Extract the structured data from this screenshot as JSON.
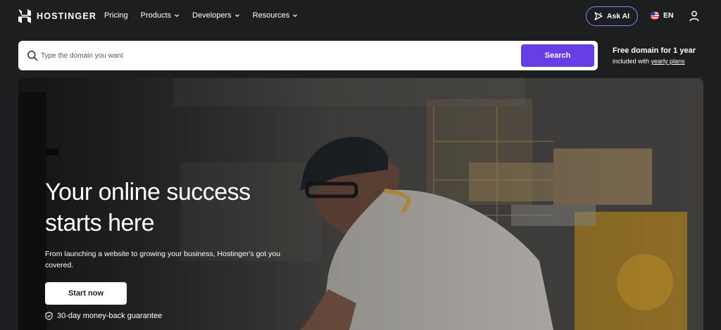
{
  "header": {
    "brand": "HOSTINGER",
    "menu": [
      {
        "label": "Pricing",
        "dropdown": false
      },
      {
        "label": "Products",
        "dropdown": true
      },
      {
        "label": "Developers",
        "dropdown": true
      },
      {
        "label": "Resources",
        "dropdown": true
      }
    ],
    "ask_ai_label": "Ask AI",
    "language_label": "EN",
    "icons": [
      "hostinger-logo-icon",
      "sparkle-icon",
      "us-flag-icon",
      "user-icon"
    ]
  },
  "search": {
    "placeholder": "Type the domain you want",
    "value": "",
    "button_label": "Search"
  },
  "promo": {
    "title": "Free domain for 1 year",
    "subtitle_prefix": "included with ",
    "subtitle_link": "yearly plans"
  },
  "hero": {
    "title_line1": "Your online success",
    "title_line2": "starts here",
    "subtitle": "From launching a website to growing your business, Hostinger's got you covered.",
    "cta_label": "Start now",
    "guarantee": "30-day money-back guarantee"
  },
  "colors": {
    "background": "#1d1e20",
    "accent": "#673de6",
    "ask_ai_border": "#8c85ff"
  }
}
